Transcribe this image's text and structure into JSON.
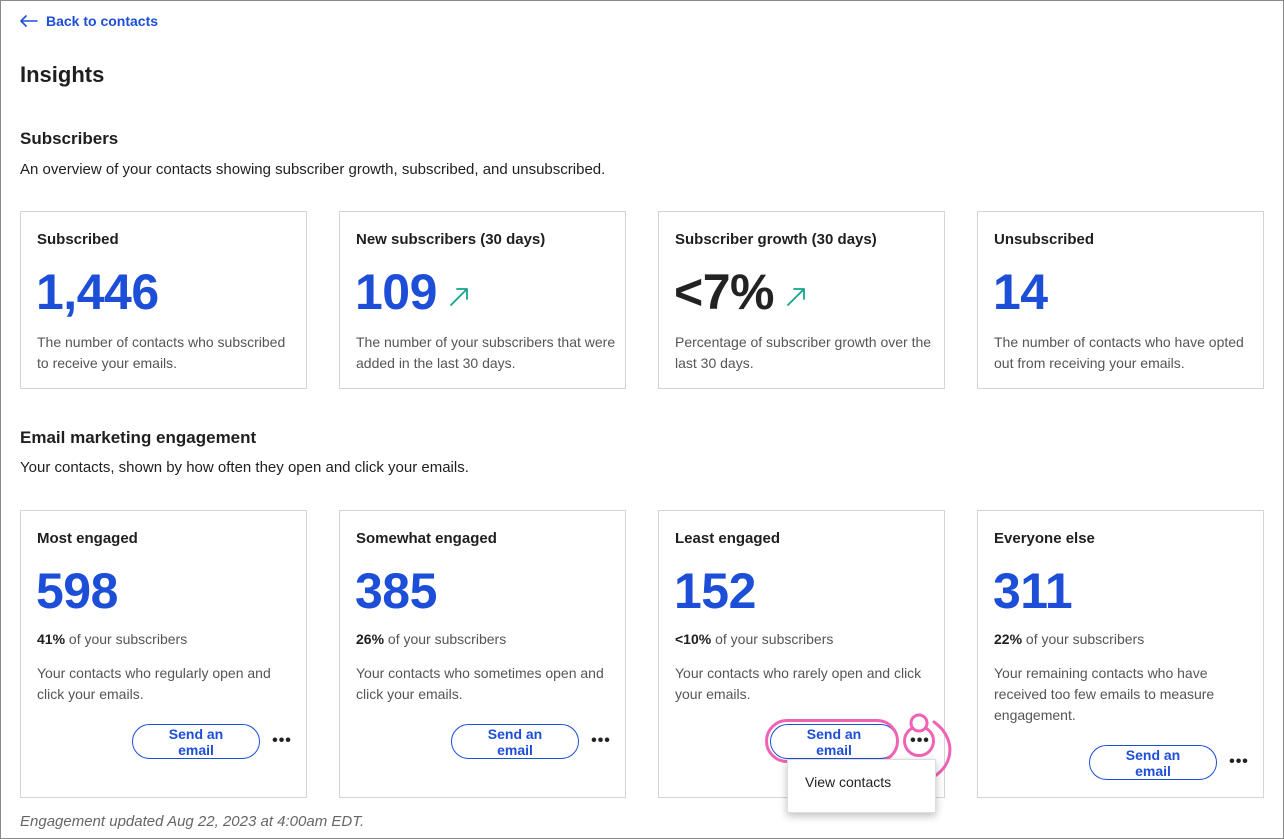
{
  "nav": {
    "back_label": "Back to contacts"
  },
  "page": {
    "title": "Insights"
  },
  "subscribers": {
    "title": "Subscribers",
    "description": "An overview of your contacts showing subscriber growth, subscribed, and unsubscribed.",
    "cards": [
      {
        "title": "Subscribed",
        "value": "1,446",
        "desc": "The number of contacts who subscribed to receive your emails."
      },
      {
        "title": "New subscribers (30 days)",
        "value": "109",
        "trend": "trending-up-icon",
        "desc": "The number of your subscribers that were added in the last 30 days."
      },
      {
        "title": "Subscriber growth (30 days)",
        "value": "<7%",
        "trend": "trending-up-icon",
        "desc": "Percentage of subscriber growth over the last 30 days."
      },
      {
        "title": "Unsubscribed",
        "value": "14",
        "desc": "The number of contacts who have opted out from receiving your emails."
      }
    ]
  },
  "engagement": {
    "title": "Email marketing engagement",
    "description": "Your contacts, shown by how often they open and click your emails.",
    "pct_suffix": "of your subscribers",
    "send_label": "Send an email",
    "more_label": "•••",
    "cards": [
      {
        "title": "Most engaged",
        "value": "598",
        "pct": "41%",
        "desc": "Your contacts who regularly open and click your emails."
      },
      {
        "title": "Somewhat engaged",
        "value": "385",
        "pct": "26%",
        "desc": "Your contacts who sometimes open and click your emails."
      },
      {
        "title": "Least engaged",
        "value": "152",
        "pct": "<10%",
        "desc": "Your contacts who rarely open and click your emails."
      },
      {
        "title": "Everyone else",
        "value": "311",
        "pct": "22%",
        "desc": "Your remaining contacts who have received too few emails to measure engagement."
      }
    ],
    "menu": {
      "item": "View contacts"
    },
    "updated_note": "Engagement updated Aug 22, 2023 at 4:00am EDT."
  },
  "colors": {
    "accent": "#1d4ed8",
    "trend": "#14a38b",
    "annotation": "#f062b4"
  }
}
